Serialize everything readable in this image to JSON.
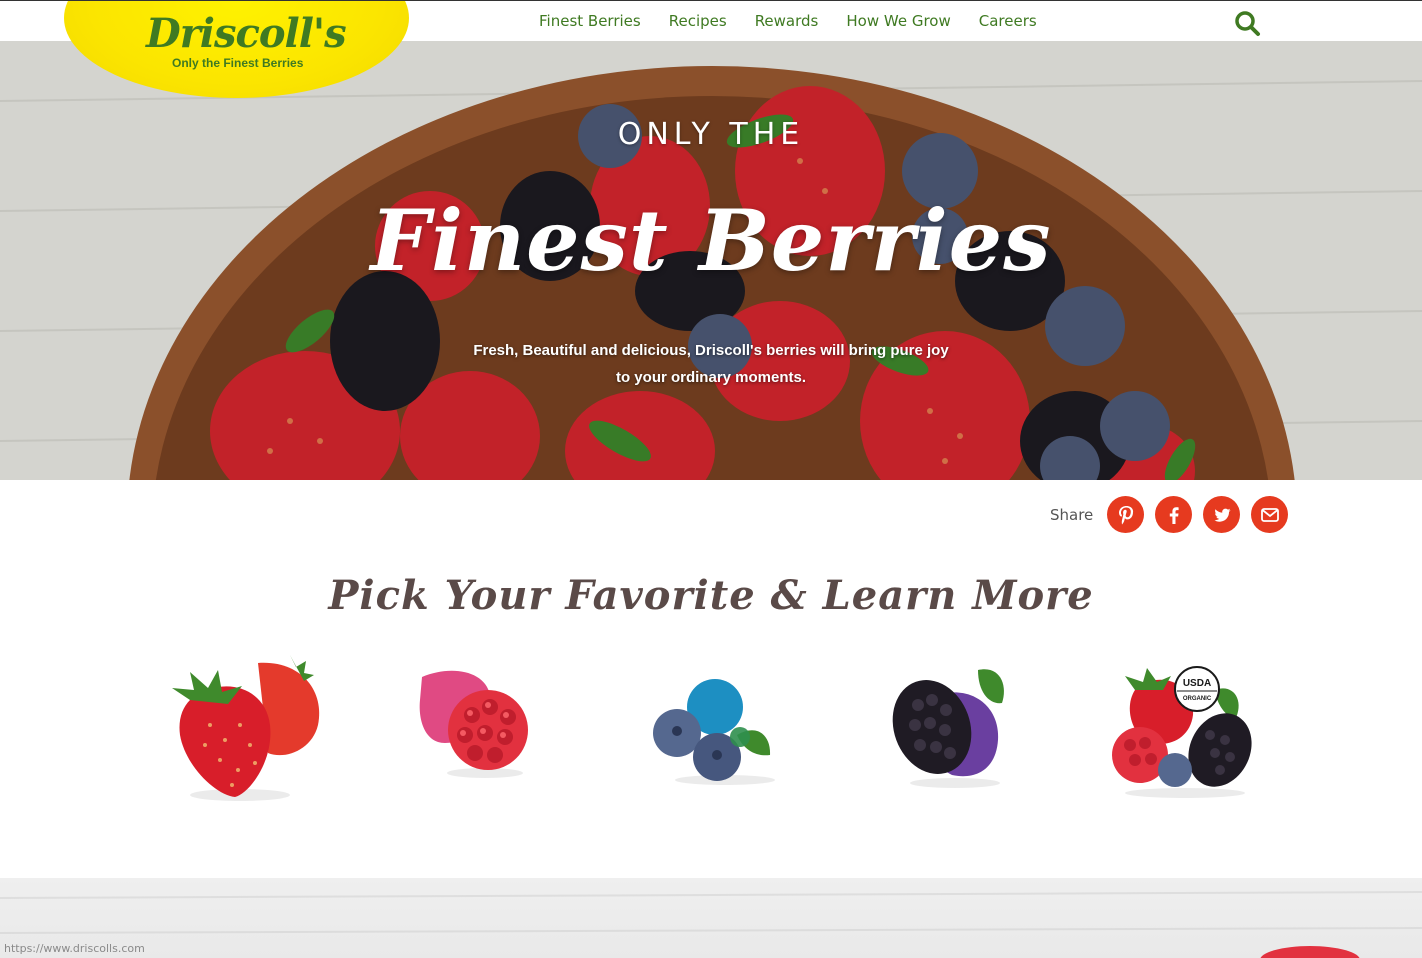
{
  "brand": {
    "name": "Driscoll's",
    "tagline": "Only the Finest Berries",
    "logo_color": "#fbe500",
    "brand_green": "#3f7a22"
  },
  "nav": {
    "items": [
      {
        "label": "Finest Berries"
      },
      {
        "label": "Recipes"
      },
      {
        "label": "Rewards"
      },
      {
        "label": "How We Grow"
      },
      {
        "label": "Careers"
      }
    ],
    "search_icon": "search-icon"
  },
  "hero": {
    "eyebrow": "ONLY THE",
    "title": "Finest Berries",
    "subtitle": "Fresh, Beautiful and delicious, Driscoll's berries will bring pure joy to your ordinary moments."
  },
  "share": {
    "label": "Share",
    "accent": "#e63a1f",
    "buttons": [
      {
        "icon": "pinterest-icon"
      },
      {
        "icon": "facebook-icon"
      },
      {
        "icon": "twitter-icon"
      },
      {
        "icon": "email-icon"
      }
    ]
  },
  "section": {
    "title": "Pick Your Favorite & Learn More"
  },
  "berries": [
    {
      "icon": "strawberry-icon"
    },
    {
      "icon": "raspberry-icon"
    },
    {
      "icon": "blueberry-icon"
    },
    {
      "icon": "blackberry-icon"
    },
    {
      "icon": "organic-berries-icon",
      "badge": "USDA ORGANIC"
    }
  ],
  "status_bar": {
    "url": "https://www.driscolls.com"
  }
}
